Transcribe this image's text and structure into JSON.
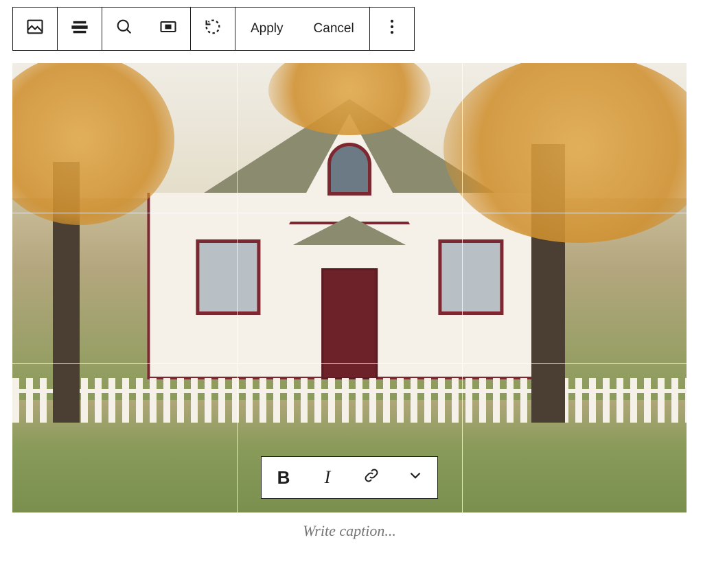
{
  "toolbar": {
    "block_type_icon": "image-block-icon",
    "alignment_icon": "alignment-full-icon",
    "zoom_icon": "zoom-icon",
    "aspect_icon": "aspect-ratio-icon",
    "rotate_icon": "rotate-icon",
    "apply_label": "Apply",
    "cancel_label": "Cancel",
    "more_icon": "more-options-icon"
  },
  "format": {
    "bold_label": "B",
    "italic_label": "I",
    "link_icon": "link-icon",
    "more_icon": "chevron-down-icon"
  },
  "caption": {
    "value": "",
    "placeholder": "Write caption..."
  }
}
